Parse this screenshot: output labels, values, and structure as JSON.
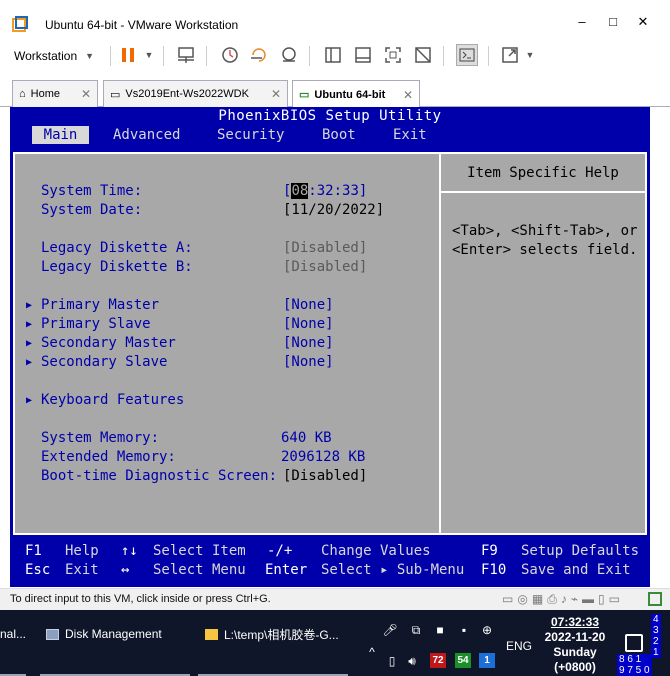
{
  "window": {
    "title": "Ubuntu 64-bit - VMware Workstation",
    "minimize": "–",
    "maximize": "□",
    "close": "✕"
  },
  "toolbar": {
    "workstation_label": "Workstation"
  },
  "tabs": [
    {
      "label": "Home",
      "icon": "home-icon"
    },
    {
      "label": "Vs2019Ent-Ws2022WDK",
      "icon": "vm-icon"
    },
    {
      "label": "Ubuntu 64-bit",
      "icon": "vm-running-icon",
      "active": true
    }
  ],
  "bios": {
    "title": "PhoenixBIOS Setup Utility",
    "menus": [
      "Main",
      "Advanced",
      "Security",
      "Boot",
      "Exit"
    ],
    "active_menu": "Main",
    "help_title": "Item Specific Help",
    "help_text": "<Tab>, <Shift-Tab>, or\n<Enter> selects field.",
    "items": {
      "system_time_label": "System Time:",
      "system_time_open": "[",
      "system_time_hour": "08",
      "system_time_rest": ":32:33]",
      "system_date_label": "System Date:",
      "system_date_value": "[11/20/2022]",
      "diskette_a_label": "Legacy Diskette A:",
      "diskette_a_value": "[Disabled]",
      "diskette_b_label": "Legacy Diskette B:",
      "diskette_b_value": "[Disabled]",
      "primary_master_label": "Primary Master",
      "primary_master_value": "[None]",
      "primary_slave_label": "Primary Slave",
      "primary_slave_value": "[None]",
      "secondary_master_label": "Secondary Master",
      "secondary_master_value": "[None]",
      "secondary_slave_label": "Secondary Slave",
      "secondary_slave_value": "[None]",
      "keyboard_label": "Keyboard Features",
      "system_memory_label": "System Memory:",
      "system_memory_value": "640 KB",
      "extended_memory_label": "Extended Memory:",
      "extended_memory_value": "2096128 KB",
      "boot_diag_label": "Boot-time Diagnostic Screen:",
      "boot_diag_value": "[Disabled]"
    },
    "footer": {
      "f1": "F1",
      "help": "Help",
      "updown": "↑↓",
      "select_item": "Select Item",
      "minusplus": "-/+",
      "change_values": "Change Values",
      "f9": "F9",
      "setup_defaults": "Setup Defaults",
      "esc": "Esc",
      "exit": "Exit",
      "leftright": "↔",
      "select_menu": "Select Menu",
      "enter": "Enter",
      "select_submenu": "Select ▸ Sub-Menu",
      "f10": "F10",
      "save_exit": "Save and Exit"
    }
  },
  "statusbar": {
    "text": "To direct input to this VM, click inside or press Ctrl+G."
  },
  "taskbar": {
    "left_fragment": "nal...",
    "disk_management": "Disk Management",
    "explorer_path": "L:\\temp\\相机胶卷-G...",
    "lang": "ENG",
    "badge1": "72",
    "badge2": "54",
    "badge3": "1",
    "clock_time": "07:32:33",
    "clock_date": "2022-11-20",
    "clock_day": "Sunday",
    "clock_tz": "(+0800)",
    "right_digits_top": "4\n3\n2\n1",
    "right_digits_bottom": "8 6 1\n9 7 5 0",
    "colors": {
      "badge1": "#c0181a",
      "badge2": "#1a8f2a",
      "badge3": "#1b6fd6"
    }
  }
}
